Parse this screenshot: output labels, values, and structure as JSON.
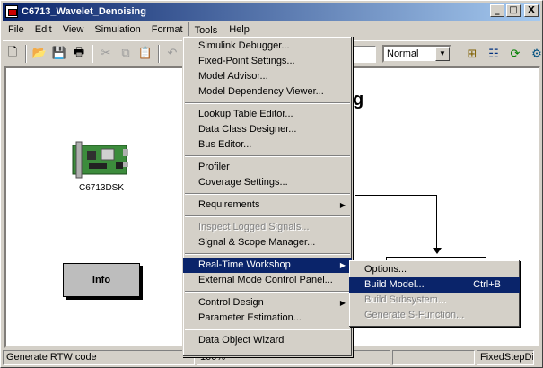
{
  "window": {
    "title": "C6713_Wavelet_Denoising",
    "controls": {
      "minimize": "_",
      "maximize": "□",
      "close": "X"
    }
  },
  "menubar": {
    "items": [
      "File",
      "Edit",
      "View",
      "Simulation",
      "Format",
      "Tools",
      "Help"
    ],
    "active": "Tools"
  },
  "toolbar": {
    "mode_value": "Normal",
    "icons": [
      "new-icon",
      "open-icon",
      "save-icon",
      "print-icon",
      "cut-icon",
      "copy-icon",
      "paste-icon",
      "undo-icon",
      "library-browser-icon",
      "model-explorer-icon",
      "refresh-icon",
      "debug-icon"
    ]
  },
  "canvas": {
    "dsk_label": "C6713DSK",
    "info_label": "Info",
    "title_fragment": "g"
  },
  "tools_menu": {
    "items": [
      {
        "label": "Simulink Debugger...",
        "enabled": true
      },
      {
        "label": "Fixed-Point Settings...",
        "enabled": true
      },
      {
        "label": "Model Advisor...",
        "enabled": true
      },
      {
        "label": "Model Dependency Viewer...",
        "enabled": true
      },
      {
        "sep": true
      },
      {
        "label": "Lookup Table Editor...",
        "enabled": true
      },
      {
        "label": "Data Class Designer...",
        "enabled": true
      },
      {
        "label": "Bus Editor...",
        "enabled": true
      },
      {
        "sep": true
      },
      {
        "label": "Profiler",
        "enabled": true
      },
      {
        "label": "Coverage Settings...",
        "enabled": true
      },
      {
        "sep": true
      },
      {
        "label": "Requirements",
        "enabled": true,
        "submenu": true
      },
      {
        "sep": true
      },
      {
        "label": "Inspect Logged Signals...",
        "enabled": false
      },
      {
        "label": "Signal & Scope Manager...",
        "enabled": true
      },
      {
        "sep": true
      },
      {
        "label": "Real-Time Workshop",
        "enabled": true,
        "submenu": true,
        "highlighted": true
      },
      {
        "label": "External Mode Control Panel...",
        "enabled": true
      },
      {
        "sep": true
      },
      {
        "label": "Control Design",
        "enabled": true,
        "submenu": true
      },
      {
        "label": "Parameter Estimation...",
        "enabled": true
      },
      {
        "sep": true
      },
      {
        "label": "Data Object Wizard",
        "enabled": true
      }
    ]
  },
  "rtw_submenu": {
    "items": [
      {
        "label": "Options...",
        "enabled": true
      },
      {
        "label": "Build Model...",
        "enabled": true,
        "shortcut": "Ctrl+B",
        "highlighted": true
      },
      {
        "label": "Build Subsystem...",
        "enabled": false
      },
      {
        "label": "Generate S-Function...",
        "enabled": false
      }
    ]
  },
  "statusbar": {
    "message": "Generate RTW code",
    "zoom": "100%",
    "solver": "FixedStepDiscrete"
  }
}
